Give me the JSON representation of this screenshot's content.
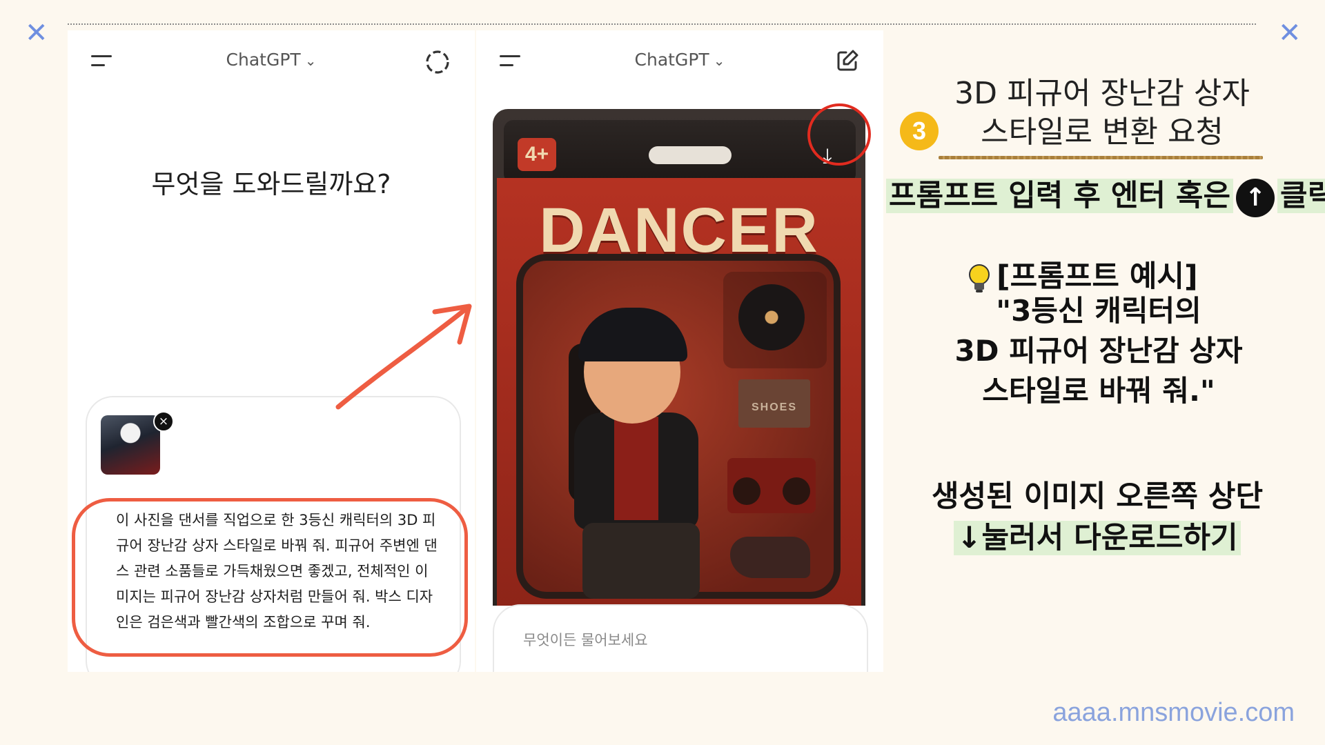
{
  "decor": {
    "corner_mark": "✕",
    "accent_color": "#ee5d42"
  },
  "left_panel": {
    "app_title": "ChatGPT",
    "greeting": "무엇을 도와드릴까요?",
    "attachment_close": "×",
    "prompt_text": "이 사진을 댄서를 직업으로 한 3등신 캐릭터의 3D 피규어 장난감 상자 스타일로 바꿔 줘. 피규어 주변엔 댄스 관련 소품들로 가득채웠으면 좋겠고, 전체적인 이미지는 피규어 장난감 상자처럼 만들어 줘. 박스 디자인은 검은색과 빨간색의 조합으로 꾸며 줘."
  },
  "right_panel": {
    "app_title": "ChatGPT",
    "image": {
      "age_badge": "4+",
      "title": "DANCER",
      "shoebox_label": "SHOES",
      "download_icon": "↓",
      "corner_download_icon": "⤓"
    },
    "composer_placeholder": "무엇이든 물어보세요"
  },
  "instructions": {
    "step_number": "3",
    "step_title_line1": "3D 피규어 장난감 상자",
    "step_title_line2": "스타일로 변환 요청",
    "enter_hint_part1": "프롬프트 입력 후 엔터 혹은",
    "enter_hint_icon": "↑",
    "enter_hint_part2": "클릭",
    "example_label": "[프롬프트 예시]",
    "example_line1": "\"3등신 캐릭터의",
    "example_line2": "3D 피규어 장난감 상자",
    "example_line3": "스타일로 바꿔 줘.\"",
    "final_line1": "생성된 이미지 오른쪽 상단",
    "final_icon": "↓",
    "final_line2": "눌러서 다운로드하기"
  },
  "watermark": "aaaa.mnsmovie.com"
}
